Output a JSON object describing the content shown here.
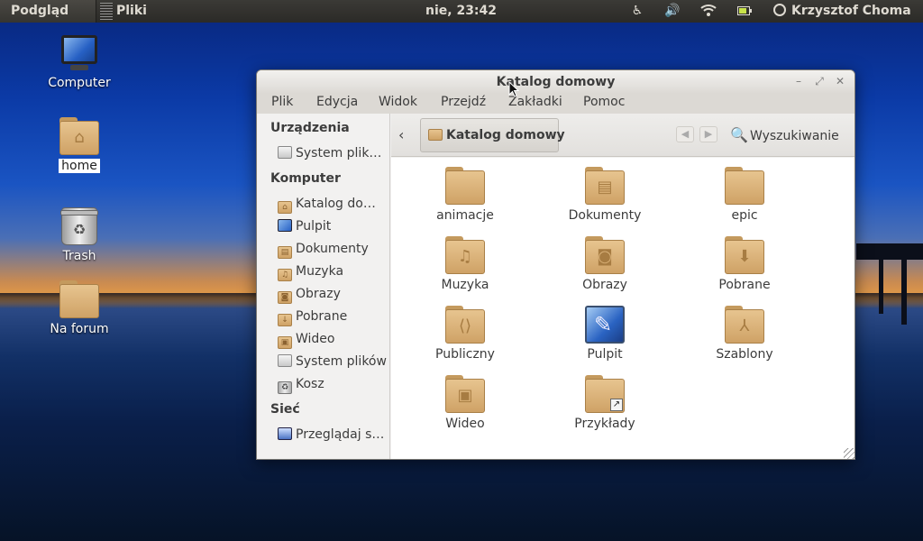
{
  "top_panel": {
    "app_menu": "Podgląd",
    "current_app": "Pliki",
    "clock": "nie, 23:42",
    "indicators": [
      "accessibility-icon",
      "volume-icon",
      "wifi-icon",
      "battery-icon"
    ],
    "user": "Krzysztof Choma"
  },
  "desktop": {
    "icons": [
      {
        "label": "Computer",
        "icon": "monitor-icon"
      },
      {
        "label": "home",
        "icon": "home-folder-icon"
      },
      {
        "label": "Trash",
        "icon": "trash-icon"
      },
      {
        "label": "Na forum",
        "icon": "folder-icon"
      }
    ]
  },
  "window": {
    "title": "Katalog domowy",
    "menu": [
      "Plik",
      "Edycja",
      "Widok",
      "Przejdź",
      "Zakładki",
      "Pomoc"
    ],
    "toolbar": {
      "path": "Katalog domowy",
      "search_label": "Wyszukiwanie"
    },
    "sidebar": {
      "sections": [
        {
          "heading": "Urządzenia",
          "items": [
            {
              "label": "System plik…",
              "icon": "drive-icon"
            }
          ]
        },
        {
          "heading": "Komputer",
          "items": [
            {
              "label": "Katalog do…",
              "icon": "home-folder-icon"
            },
            {
              "label": "Pulpit",
              "icon": "desktop-icon"
            },
            {
              "label": "Dokumenty",
              "icon": "documents-folder-icon"
            },
            {
              "label": "Muzyka",
              "icon": "music-folder-icon"
            },
            {
              "label": "Obrazy",
              "icon": "pictures-folder-icon"
            },
            {
              "label": "Pobrane",
              "icon": "downloads-folder-icon"
            },
            {
              "label": "Wideo",
              "icon": "videos-folder-icon"
            },
            {
              "label": "System plików",
              "icon": "drive-icon"
            },
            {
              "label": "Kosz",
              "icon": "trash-icon"
            }
          ]
        },
        {
          "heading": "Sieć",
          "items": [
            {
              "label": "Przeglądaj s…",
              "icon": "network-icon"
            }
          ]
        }
      ]
    },
    "files": [
      {
        "label": "animacje",
        "icon": "folder-icon"
      },
      {
        "label": "Dokumenty",
        "icon": "documents-folder-icon"
      },
      {
        "label": "epic",
        "icon": "folder-icon"
      },
      {
        "label": "Muzyka",
        "icon": "music-folder-icon"
      },
      {
        "label": "Obrazy",
        "icon": "pictures-folder-icon"
      },
      {
        "label": "Pobrane",
        "icon": "downloads-folder-icon"
      },
      {
        "label": "Publiczny",
        "icon": "public-folder-icon"
      },
      {
        "label": "Pulpit",
        "icon": "desktop-icon"
      },
      {
        "label": "Szablony",
        "icon": "templates-folder-icon"
      },
      {
        "label": "Wideo",
        "icon": "videos-folder-icon"
      },
      {
        "label": "Przykłady",
        "icon": "link-folder-icon"
      }
    ]
  }
}
